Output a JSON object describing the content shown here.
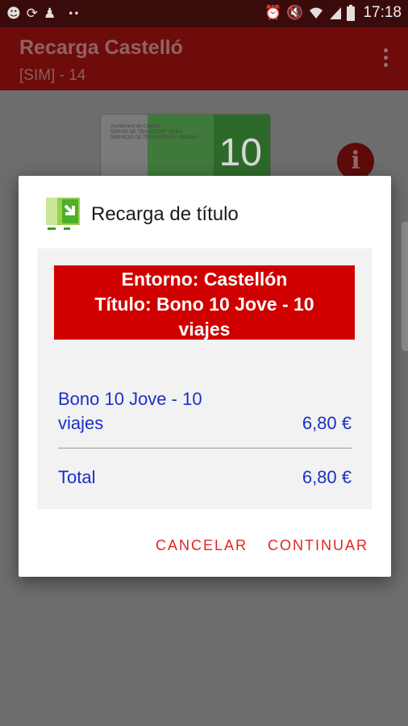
{
  "status_bar": {
    "time": "17:18",
    "left_icons": [
      "whatsapp-icon",
      "sync-icon",
      "person-icon",
      "more-dots-icon"
    ],
    "right_icons": [
      "alarm-icon",
      "mute-icon",
      "wifi-icon",
      "signal-icon",
      "battery-icon"
    ]
  },
  "app_bar": {
    "title": "Recarga Castelló",
    "subtitle": "[SIM] - 14"
  },
  "background": {
    "card_number": "10",
    "card_text": "Ajuntament de Castelló\nSERVEI DE TRANSPORT URBÀ\nSERVICIO DE TRANSPORTE URBANO",
    "info_icon": "i"
  },
  "dialog": {
    "title": "Recarga de título",
    "banner_line1": "Entorno: Castellón",
    "banner_line2": "Título: Bono 10 Jove - 10",
    "banner_line3": "viajes",
    "item_name": "Bono 10 Jove - 10 viajes",
    "item_price": "6,80 €",
    "total_label": "Total",
    "total_value": "6,80 €",
    "cancel_label": "CANCELAR",
    "continue_label": "CONTINUAR"
  },
  "colors": {
    "app_bar": "#6e0b0b",
    "status_bar": "#3a0b0b",
    "banner": "#d00000",
    "link_text": "#1b2fc8",
    "button_text": "#e02525"
  }
}
